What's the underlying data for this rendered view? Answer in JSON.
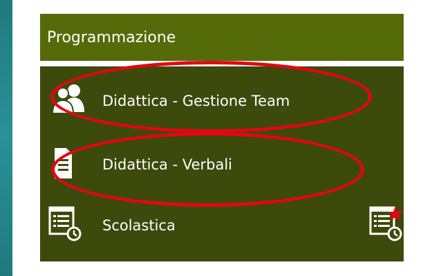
{
  "menu": {
    "header_title": "Programmazione",
    "items": [
      {
        "label": "Didattica - Gestione Team",
        "icon": "team-icon"
      },
      {
        "label": "Didattica - Verbali",
        "icon": "document-icon"
      },
      {
        "label": "Scolastica",
        "icon": "schedule-list-icon",
        "favorite_icon": "schedule-favorite-star-icon"
      }
    ]
  },
  "colors": {
    "header_bg": "#556b0a",
    "body_bg": "#3c4a0b",
    "text": "#ffffff",
    "highlight": "#e30613",
    "favorite_star": "#e30613"
  }
}
